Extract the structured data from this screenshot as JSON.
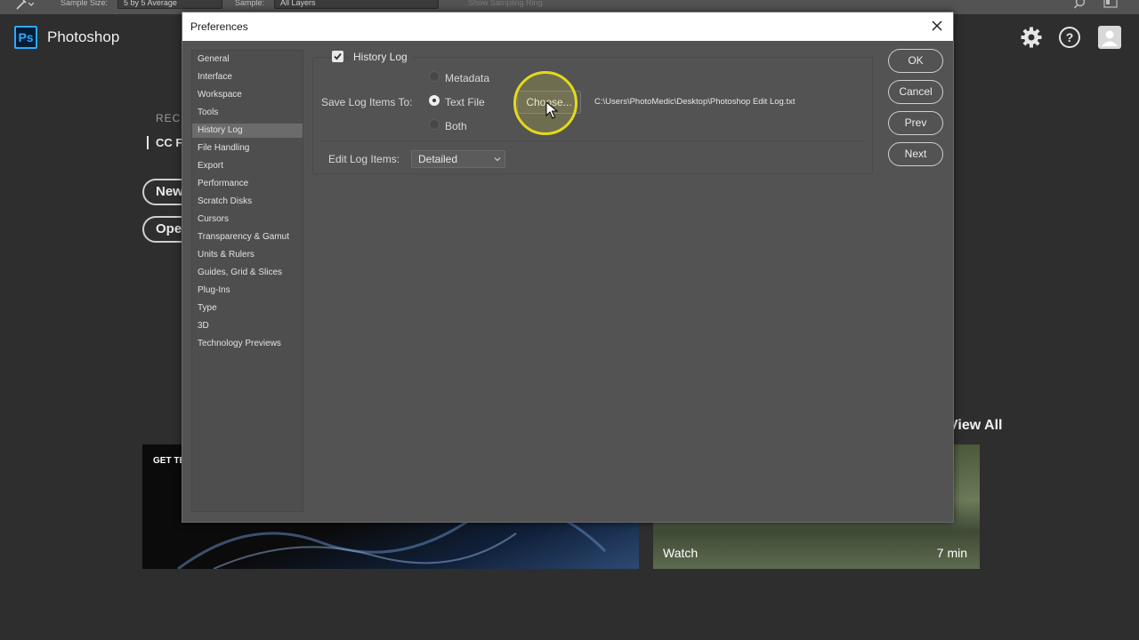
{
  "options_bar": {
    "sample_size_label": "Sample Size:",
    "sample_size_value": "5 by 5 Average",
    "sample_label": "Sample:",
    "sample_value": "All Layers",
    "show_sampling_ring": "Show Sampling Ring"
  },
  "app": {
    "logo": "Ps",
    "name": "Photoshop"
  },
  "home": {
    "recent_heading": "RECE",
    "cc_files_tab": "CC FI",
    "new_button": "New",
    "open_button": "Open",
    "view_all": "View All",
    "card1_title": "GET TE",
    "card2_watch": "Watch",
    "card2_duration": "7 min"
  },
  "dialog": {
    "title": "Preferences",
    "nav_items": [
      "General",
      "Interface",
      "Workspace",
      "Tools",
      "History Log",
      "File Handling",
      "Export",
      "Performance",
      "Scratch Disks",
      "Cursors",
      "Transparency & Gamut",
      "Units & Rulers",
      "Guides, Grid & Slices",
      "Plug-Ins",
      "Type",
      "3D",
      "Technology Previews"
    ],
    "active_nav": "History Log",
    "history_log_label": "History Log",
    "history_log_checked": true,
    "save_log_items_to_label": "Save Log Items To:",
    "radio_options": [
      "Metadata",
      "Text File",
      "Both"
    ],
    "selected_radio": "Text File",
    "choose_button": "Choose...",
    "log_file_path": "C:\\Users\\PhotoMedic\\Desktop\\Photoshop Edit Log.txt",
    "edit_log_items_label": "Edit Log Items:",
    "edit_log_items_value": "Detailed",
    "buttons": {
      "ok": "OK",
      "cancel": "Cancel",
      "prev": "Prev",
      "next": "Next"
    }
  },
  "colors": {
    "app_background": "#2e2e2e",
    "dialog_background": "#535353",
    "accent_ps": "#31a8ff",
    "cursor_highlight": "#e3d91c"
  }
}
